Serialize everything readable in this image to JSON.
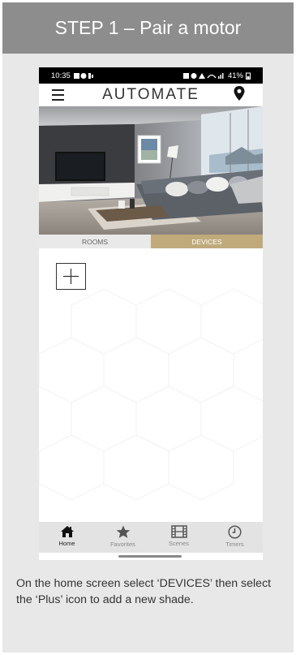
{
  "header": {
    "title": "STEP 1 – Pair a motor"
  },
  "status_bar": {
    "time": "10:35",
    "battery": "41%"
  },
  "app": {
    "brand": "AUTOMATE"
  },
  "tabs": [
    {
      "label": "ROOMS",
      "active": false
    },
    {
      "label": "DEVICES",
      "active": true
    }
  ],
  "colors": {
    "header_bg": "#8d8d8d",
    "card_bg": "#e8e8e8",
    "active_tab": "#c0aa7c"
  },
  "bottom_nav": [
    {
      "label": "Home",
      "icon": "home-icon",
      "active": true
    },
    {
      "label": "Favorites",
      "icon": "star-icon",
      "active": false
    },
    {
      "label": "Scenes",
      "icon": "film-icon",
      "active": false
    },
    {
      "label": "Timers",
      "icon": "clock-icon",
      "active": false
    }
  ],
  "caption": {
    "text": "On the home screen select ‘DEVICES’ then select the ‘Plus’ icon to add a new shade."
  }
}
